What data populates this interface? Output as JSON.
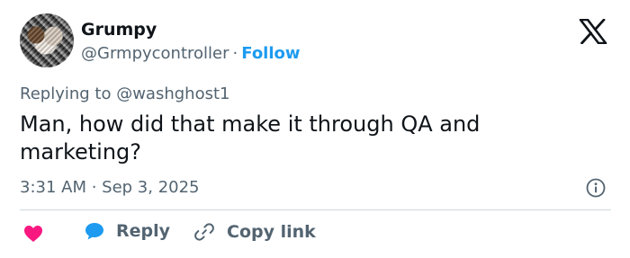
{
  "author": {
    "display_name": "Grumpy",
    "handle": "@Grmpycontroller",
    "separator": "·",
    "follow_label": "Follow",
    "avatar": "cat-photo-avatar"
  },
  "reply_context": "Replying to @washghost1",
  "tweet_text": "Man, how did that make it through QA and marketing?",
  "timestamp": "3:31 AM · Sep 3, 2025",
  "actions": {
    "like_icon": "heart-icon",
    "reply_label": "Reply",
    "reply_icon": "speech-bubble-icon",
    "copy_label": "Copy link",
    "copy_icon": "link-icon"
  },
  "icons": {
    "brand": "x-logo-icon",
    "info": "info-icon"
  },
  "colors": {
    "accent": "#1d9bf0",
    "heart": "#f91880",
    "muted_text": "#536471",
    "text": "#0f1419",
    "divider": "#cfd9de"
  }
}
